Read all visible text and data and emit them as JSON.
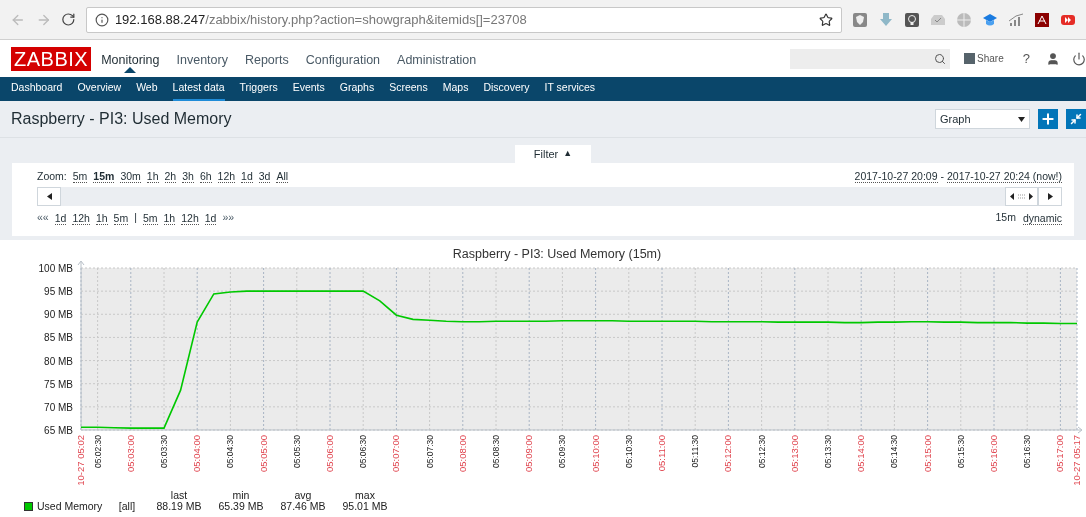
{
  "browser": {
    "address": {
      "host": "192.168.88.247",
      "path": "/zabbix/history.php?action=showgraph&itemids[]=23708"
    }
  },
  "header": {
    "logo": "ZABBIX",
    "menu": [
      {
        "label": "Monitoring",
        "selected": true
      },
      {
        "label": "Inventory",
        "selected": false
      },
      {
        "label": "Reports",
        "selected": false
      },
      {
        "label": "Configuration",
        "selected": false
      },
      {
        "label": "Administration",
        "selected": false
      }
    ],
    "share": "Share",
    "help": "?"
  },
  "submenu": [
    {
      "label": "Dashboard",
      "selected": false
    },
    {
      "label": "Overview",
      "selected": false
    },
    {
      "label": "Web",
      "selected": false
    },
    {
      "label": "Latest data",
      "selected": true
    },
    {
      "label": "Triggers",
      "selected": false
    },
    {
      "label": "Events",
      "selected": false
    },
    {
      "label": "Graphs",
      "selected": false
    },
    {
      "label": "Screens",
      "selected": false
    },
    {
      "label": "Maps",
      "selected": false
    },
    {
      "label": "Discovery",
      "selected": false
    },
    {
      "label": "IT services",
      "selected": false
    }
  ],
  "page_title": "Raspberry - PI3: Used Memory",
  "view_select": "Graph",
  "filter": {
    "tab": "Filter",
    "tab_arrow": "▲",
    "zoom_label": "Zoom:",
    "zoom": [
      {
        "label": "5m",
        "selected": false
      },
      {
        "label": "15m",
        "selected": true
      },
      {
        "label": "30m",
        "selected": false
      },
      {
        "label": "1h",
        "selected": false
      },
      {
        "label": "2h",
        "selected": false
      },
      {
        "label": "3h",
        "selected": false
      },
      {
        "label": "6h",
        "selected": false
      },
      {
        "label": "12h",
        "selected": false
      },
      {
        "label": "1d",
        "selected": false
      },
      {
        "label": "3d",
        "selected": false
      },
      {
        "label": "All",
        "selected": false
      }
    ],
    "from": "2017-10-27 20:09",
    "dash": "-",
    "to": "2017-10-27 20:24 (now!)",
    "back_all": "««",
    "back": [
      "1d",
      "12h",
      "1h",
      "5m"
    ],
    "separator": "|",
    "forward": [
      "5m",
      "1h",
      "12h",
      "1d"
    ],
    "forward_all": "»»",
    "period": "15m",
    "mode": "dynamic"
  },
  "graph": {
    "chart_data": {
      "type": "line",
      "grid": true,
      "title": "Raspberry - PI3: Used Memory (15m)",
      "ylim": [
        65,
        100
      ],
      "yticks": [
        {
          "value": 65,
          "label": "65 MB"
        },
        {
          "value": 70,
          "label": "70 MB"
        },
        {
          "value": 75,
          "label": "75 MB"
        },
        {
          "value": 80,
          "label": "80 MB"
        },
        {
          "value": 85,
          "label": "85 MB"
        },
        {
          "value": 90,
          "label": "90 MB"
        },
        {
          "value": 95,
          "label": "95 MB"
        },
        {
          "value": 100,
          "label": "100 MB"
        }
      ],
      "categories": [
        "10-27 05:02",
        "05:02:30",
        null,
        "05:03:00",
        null,
        "05:03:30",
        null,
        "05:04:00",
        null,
        "05:04:30",
        null,
        "05:05:00",
        null,
        "05:05:30",
        null,
        "05:06:00",
        null,
        "05:06:30",
        null,
        "05:07:00",
        null,
        "05:07:30",
        null,
        "05:08:00",
        null,
        "05:08:30",
        null,
        "05:09:00",
        null,
        "05:09:30",
        null,
        "05:10:00",
        null,
        "05:10:30",
        null,
        "05:11:00",
        null,
        "05:11:30",
        null,
        "05:12:00",
        null,
        "05:12:30",
        null,
        "05:13:00",
        null,
        "05:13:30",
        null,
        "05:14:00",
        null,
        "05:14:30",
        null,
        "05:15:00",
        null,
        "05:15:30",
        null,
        "05:16:00",
        null,
        "05:16:30",
        null,
        "05:17:00",
        "10-27 05:17"
      ],
      "series": [
        {
          "name": "Used Memory",
          "color": "#00c800",
          "values": [
            65.6,
            65.6,
            65.5,
            65.4,
            65.4,
            65.4,
            73.6,
            88.3,
            94.4,
            94.8,
            95.0,
            95.0,
            95.0,
            95.0,
            95.0,
            95.0,
            95.0,
            95.0,
            92.9,
            89.8,
            88.9,
            88.7,
            88.5,
            88.4,
            88.4,
            88.5,
            88.5,
            88.5,
            88.5,
            88.6,
            88.6,
            88.6,
            88.6,
            88.5,
            88.5,
            88.5,
            88.5,
            88.5,
            88.4,
            88.4,
            88.4,
            88.4,
            88.3,
            88.3,
            88.3,
            88.3,
            88.2,
            88.2,
            88.3,
            88.3,
            88.4,
            88.4,
            88.3,
            88.3,
            88.2,
            88.2,
            88.2,
            88.1,
            88.1,
            88.0,
            88.0
          ]
        }
      ]
    },
    "legend": {
      "headers": [
        "last",
        "min",
        "avg",
        "max"
      ],
      "rows": [
        {
          "func": "[all]",
          "values": [
            "88.19 MB",
            "65.39 MB",
            "87.46 MB",
            "95.01 MB"
          ]
        }
      ]
    }
  }
}
